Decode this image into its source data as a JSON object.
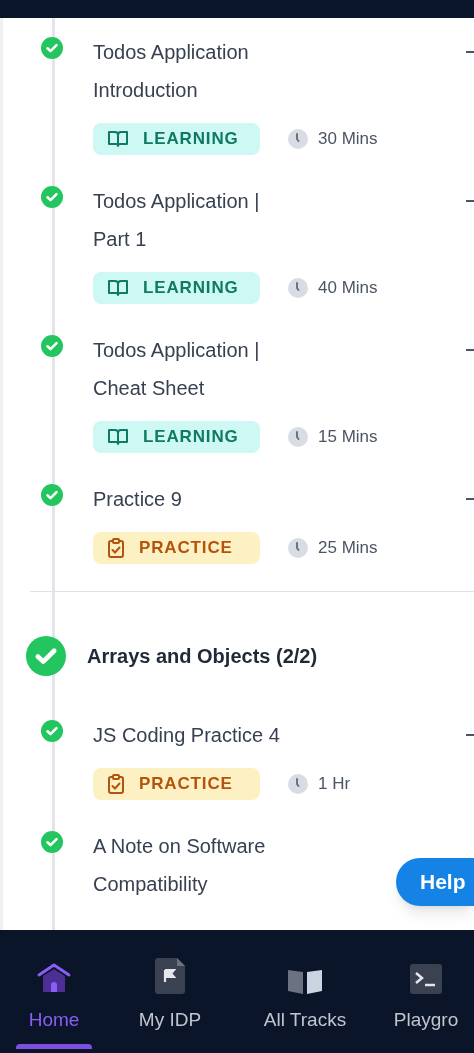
{
  "sections": [
    {
      "items": [
        {
          "title": "Todos Application Introduction",
          "completed": true,
          "badge": {
            "kind": "learning",
            "label": "LEARNING"
          },
          "duration": "30 Mins"
        },
        {
          "title": "Todos Application | Part 1",
          "completed": true,
          "badge": {
            "kind": "learning",
            "label": "LEARNING"
          },
          "duration": "40 Mins"
        },
        {
          "title": "Todos Application | Cheat Sheet",
          "completed": true,
          "badge": {
            "kind": "learning",
            "label": "LEARNING"
          },
          "duration": "15 Mins"
        },
        {
          "title": "Practice 9",
          "completed": true,
          "badge": {
            "kind": "practice",
            "label": "PRACTICE"
          },
          "duration": "25 Mins"
        }
      ]
    },
    {
      "header": {
        "title": "Arrays and Objects (2/2)",
        "completed": true
      },
      "items": [
        {
          "title": "JS Coding Practice 4",
          "completed": true,
          "badge": {
            "kind": "practice",
            "label": "PRACTICE"
          },
          "duration": "1 Hr"
        },
        {
          "title": "A Note on Software Compatibility",
          "completed": true
        }
      ]
    }
  ],
  "help_button": "Help",
  "bottom_nav": [
    {
      "label": "Home",
      "selected": true
    },
    {
      "label": "My IDP",
      "selected": false
    },
    {
      "label": "All Tracks",
      "selected": false
    },
    {
      "label": "Playgro",
      "selected": false
    }
  ]
}
